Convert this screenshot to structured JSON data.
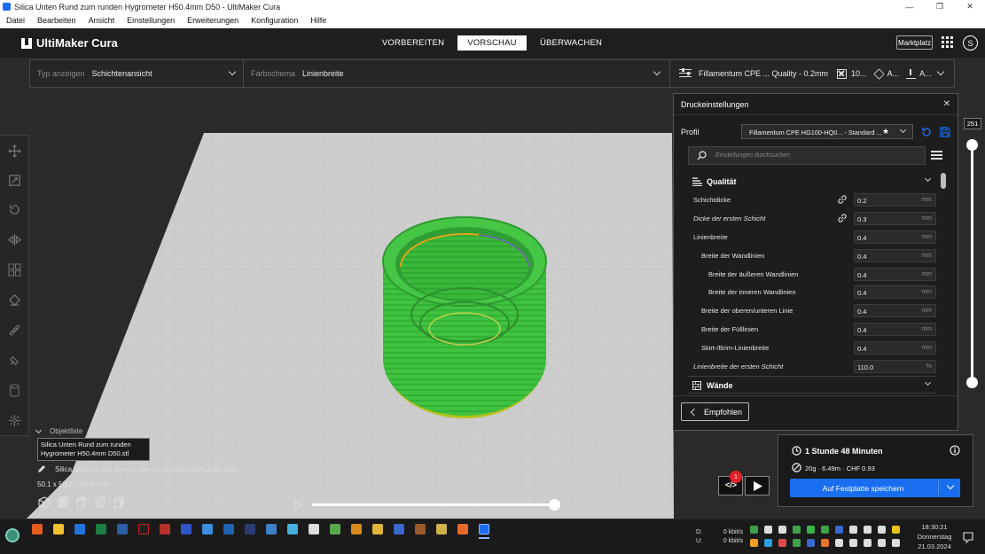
{
  "window": {
    "title": "Silica Unten Rund zum runden Hygrometer H50.4mm D50 - UltiMaker Cura"
  },
  "menu": [
    "Datei",
    "Bearbeiten",
    "Ansicht",
    "Einstellungen",
    "Erweiterungen",
    "Konfiguration",
    "Hilfe"
  ],
  "header": {
    "logo": "UltiMaker Cura",
    "stages": [
      "VORBEREITEN",
      "VORSCHAU",
      "ÜBERWACHEN"
    ],
    "active_stage": "VORSCHAU",
    "marketplace": "Marktplatz",
    "account_initial": "S"
  },
  "viewbar": {
    "type_label": "Typ anzeigen",
    "type_value": "Schichtenansicht",
    "scheme_label": "Farbschema",
    "scheme_value": "Linienbreite",
    "material_summary": "Fillamentum CPE ... Quality - 0.2mm",
    "infill_value": "10...",
    "support_value": "A...",
    "adhesion_value": "A..."
  },
  "settings_panel": {
    "title": "Druckeinstellungen",
    "profile_label": "Profil",
    "profile_value": "Fillamentum CPE HG100-HQ0... - Standard ...",
    "search_placeholder": "Einstellungen durchsuchen",
    "section_quality": "Qualität",
    "section_walls": "Wände",
    "rows": [
      {
        "name": "Schichtdicke",
        "value": "0.2",
        "unit": "mm",
        "indent": 0,
        "italic": false,
        "link": true
      },
      {
        "name": "Dicke der ersten Schicht",
        "value": "0.3",
        "unit": "mm",
        "indent": 0,
        "italic": true,
        "link": true
      },
      {
        "name": "Linienbreite",
        "value": "0.4",
        "unit": "mm",
        "indent": 0,
        "italic": false,
        "link": false
      },
      {
        "name": "Breite der Wandlinien",
        "value": "0.4",
        "unit": "mm",
        "indent": 1,
        "italic": false,
        "link": false
      },
      {
        "name": "Breite der äußeren Wandlinien",
        "value": "0.4",
        "unit": "mm",
        "indent": 2,
        "italic": false,
        "link": false
      },
      {
        "name": "Breite der inneren Wandlinien",
        "value": "0.4",
        "unit": "mm",
        "indent": 2,
        "italic": false,
        "link": false
      },
      {
        "name": "Breite der oberen/unteren Linie",
        "value": "0.4",
        "unit": "mm",
        "indent": 1,
        "italic": false,
        "link": false
      },
      {
        "name": "Breite der Fülllinien",
        "value": "0.4",
        "unit": "mm",
        "indent": 1,
        "italic": false,
        "link": false
      },
      {
        "name": "Skirt-/Brim-Linienbreite",
        "value": "0.4",
        "unit": "mm",
        "indent": 1,
        "italic": false,
        "link": false
      },
      {
        "name": "Linienbreite der ersten Schicht",
        "value": "110.0",
        "unit": "%",
        "indent": 0,
        "italic": true,
        "link": false
      }
    ],
    "recommended_button": "Empfohlen"
  },
  "layer_slider": {
    "max_layer": "251",
    "position": 1.0
  },
  "object_list": {
    "title": "Objektliste",
    "tooltip": "Silica Unten Rund zum runden Hygrometer H50.4mm D50.stl",
    "object_name": "Silica Unten Rund zum runden Hygrometer H50.4mm D50",
    "dimensions": "50.1 x 50.1 x 50.4 mm"
  },
  "preview_slider": {
    "position": 0.996
  },
  "action_panel": {
    "badge_count": "1",
    "print_time": "1 Stunde 48 Minuten",
    "material_info": "20g · 6.49m · CHF 0.93",
    "save_button": "Auf Festplatte speichern"
  },
  "taskbar": {
    "net_down_label": "D:",
    "net_down": "0 kbit/s",
    "net_up_label": "U:",
    "net_up": "0 kbit/s",
    "time": "18:30:21",
    "day": "Donnerstag",
    "date": "21.03.2024"
  },
  "colors": {
    "accent": "#196ef0",
    "model_green": "#3fc23f",
    "bed": "#cfcfcf",
    "brim_yellow": "#b7c21a"
  }
}
